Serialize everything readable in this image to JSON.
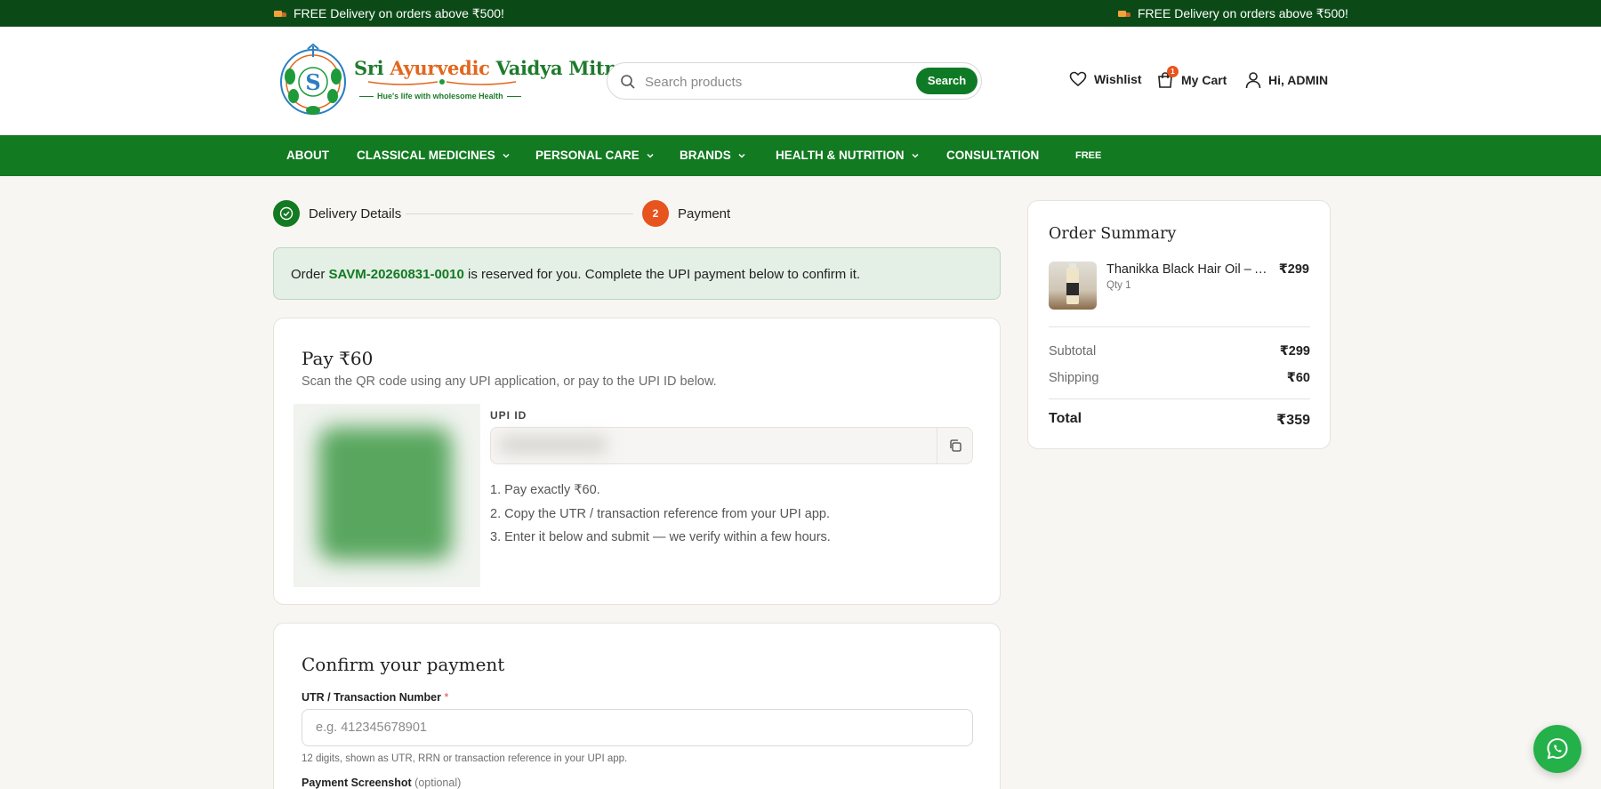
{
  "announcement": {
    "left": "FREE Delivery on orders above ₹500!",
    "right": "FREE Delivery on orders above ₹500!"
  },
  "brand": {
    "name_part1": "Sri ",
    "name_part2": "Ayurvedic",
    "name_part3": " Vaidya Mitra",
    "tagline": "Hue's life with wholesome Health"
  },
  "search": {
    "placeholder": "Search products",
    "button_label": "Search"
  },
  "header": {
    "wishlist_label": "Wishlist",
    "cart_label": "My Cart",
    "cart_count": "1",
    "user_label": "Hi, ADMIN"
  },
  "nav": {
    "items": [
      {
        "label": "ABOUT"
      },
      {
        "label": "CLASSICAL MEDICINES"
      },
      {
        "label": "PERSONAL CARE"
      },
      {
        "label": "BRANDS"
      },
      {
        "label": "HEALTH & NUTRITION"
      },
      {
        "label": "CONSULTATION"
      },
      {
        "label": "FREE"
      }
    ]
  },
  "stepper": {
    "step1_label": "Delivery Details",
    "step2_number": "2",
    "step2_label": "Payment"
  },
  "notice": {
    "prefix": "Order ",
    "order_id": "SAVM-20260831-0010",
    "suffix": " is reserved for you. Complete the UPI payment below to confirm it."
  },
  "payment": {
    "title": "Pay ₹60",
    "subtitle": "Scan the QR code using any UPI application, or pay to the UPI ID below.",
    "upi_label": "UPI ID",
    "instructions": [
      "1. Pay exactly ₹60.",
      "2. Copy the UTR / transaction reference from your UPI app.",
      "3. Enter it below and submit — we verify within a few hours."
    ]
  },
  "confirm": {
    "title": "Confirm your payment",
    "utr_label": "UTR / Transaction Number",
    "utr_required": "*",
    "utr_placeholder": "e.g. 412345678901",
    "utr_hint": "12 digits, shown as UTR, RRN or transaction reference in your UPI app.",
    "screenshot_label": "Payment Screenshot",
    "screenshot_optional": "(optional)"
  },
  "summary": {
    "title": "Order Summary",
    "product_name": "Thanikka Black Hair Oil – A...",
    "product_qty": "Qty 1",
    "product_price": "₹299",
    "subtotal_label": "Subtotal",
    "subtotal_value": "₹299",
    "shipping_label": "Shipping",
    "shipping_value": "₹60",
    "total_label": "Total",
    "total_value": "₹359"
  },
  "colors": {
    "brand_green": "#127a21",
    "dark_green": "#0b4a17",
    "accent_orange": "#e8541e"
  }
}
